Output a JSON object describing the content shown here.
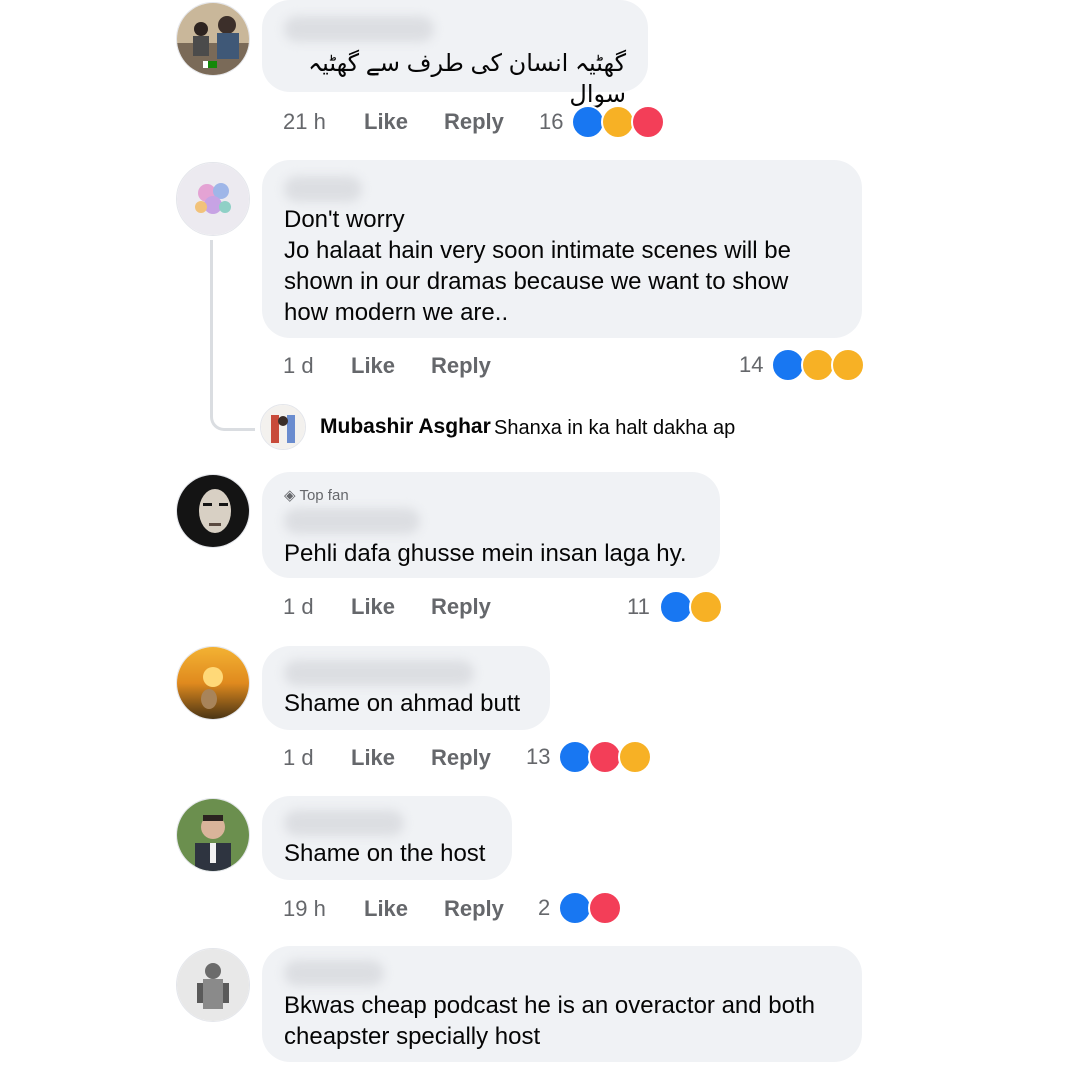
{
  "comments": [
    {
      "text": "گھٹیہ انسان کی طرف سے گھٹیہ سوال",
      "time": "21 h",
      "like": "Like",
      "reply": "Reply",
      "count": "16",
      "reactions": [
        "like-icon",
        "haha-icon",
        "love-icon"
      ]
    },
    {
      "text": "Don't worry\nJo halaat hain very soon intimate scenes will be\nshown in our dramas because we want to show\nhow modern we are..",
      "time": "1 d",
      "like": "Like",
      "reply": "Reply",
      "count": "14",
      "reactions": [
        "like-icon",
        "haha-icon",
        "sad-icon"
      ],
      "replies": [
        {
          "name": "Mubashir Asghar",
          "text": "Shanxa in ka halt dakha ap"
        }
      ]
    },
    {
      "badge": "Top fan",
      "text": "Pehli dafa ghusse mein insan laga hy.",
      "time": "1 d",
      "like": "Like",
      "reply": "Reply",
      "count": "11",
      "reactions": [
        "like-icon",
        "haha-icon"
      ]
    },
    {
      "text": "Shame on ahmad butt",
      "time": "1 d",
      "like": "Like",
      "reply": "Reply",
      "count": "13",
      "reactions": [
        "like-icon",
        "love-icon",
        "haha-icon"
      ]
    },
    {
      "text": "Shame on the host",
      "time": "19 h",
      "like": "Like",
      "reply": "Reply",
      "count": "2",
      "reactions": [
        "like-icon",
        "love-icon"
      ]
    },
    {
      "text": "Bkwas cheap podcast he is an overactor and both\ncheapster specially host"
    }
  ],
  "colors": {
    "bubble": "#f0f2f5",
    "meta_text": "#65676b",
    "like": "#1877f2",
    "love": "#f33e58",
    "haha": "#f7b125"
  }
}
